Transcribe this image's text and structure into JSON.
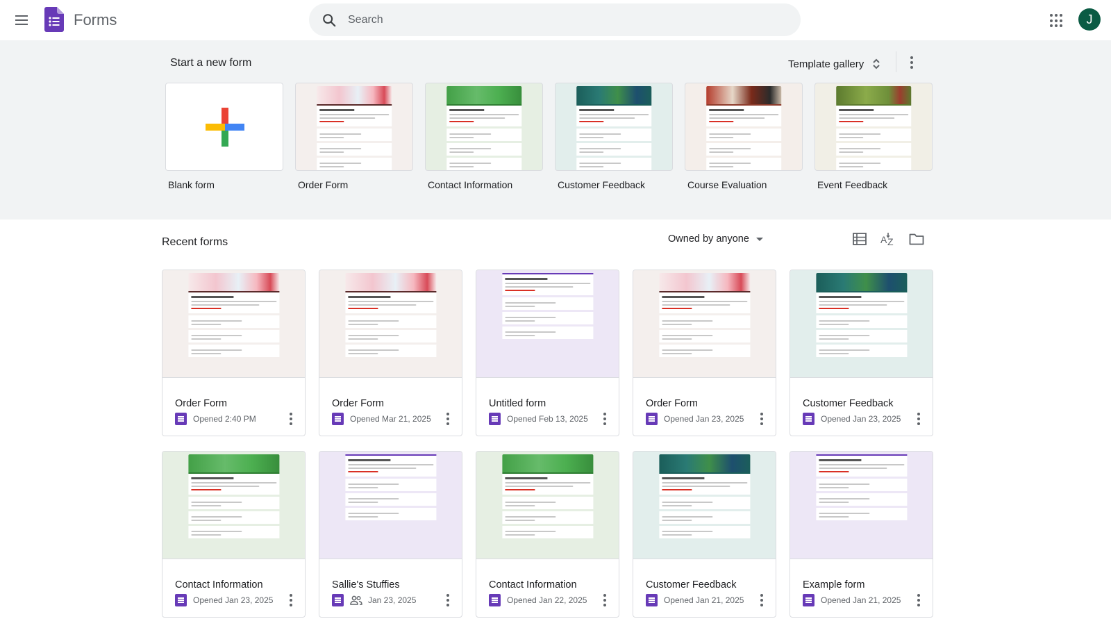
{
  "header": {
    "app_title": "Forms",
    "search_placeholder": "Search",
    "avatar_initial": "J"
  },
  "templates": {
    "heading": "Start a new form",
    "gallery_label": "Template gallery",
    "items": [
      {
        "name": "Blank form",
        "style": "blank"
      },
      {
        "name": "Order Form",
        "style": "floral"
      },
      {
        "name": "Contact Information",
        "style": "green"
      },
      {
        "name": "Customer Feedback",
        "style": "teal"
      },
      {
        "name": "Course Evaluation",
        "style": "grad"
      },
      {
        "name": "Event Feedback",
        "style": "park"
      }
    ]
  },
  "recent": {
    "heading": "Recent forms",
    "owner_filter": "Owned by anyone",
    "forms": [
      {
        "title": "Order Form",
        "opened": "Opened 2:40 PM",
        "style": "floral",
        "shared": false
      },
      {
        "title": "Order Form",
        "opened": "Opened Mar 21, 2025",
        "style": "floral",
        "shared": false
      },
      {
        "title": "Untitled form",
        "opened": "Opened Feb 13, 2025",
        "style": "plain",
        "shared": false
      },
      {
        "title": "Order Form",
        "opened": "Opened Jan 23, 2025",
        "style": "floral",
        "shared": false
      },
      {
        "title": "Customer Feedback",
        "opened": "Opened Jan 23, 2025",
        "style": "teal",
        "shared": false
      },
      {
        "title": "Contact Information",
        "opened": "Opened Jan 23, 2025",
        "style": "green",
        "shared": false
      },
      {
        "title": "Sallie's Stuffies",
        "opened": "Jan 23, 2025",
        "style": "plain",
        "shared": true
      },
      {
        "title": "Contact Information",
        "opened": "Opened Jan 22, 2025",
        "style": "green",
        "shared": false
      },
      {
        "title": "Customer Feedback",
        "opened": "Opened Jan 21, 2025",
        "style": "teal",
        "shared": false
      },
      {
        "title": "Example form",
        "opened": "Opened Jan 21, 2025",
        "style": "plain",
        "shared": false
      }
    ]
  },
  "colors": {
    "forms_purple": "#673ab7",
    "avatar_green": "#0b5b44",
    "floral_bg": "#f4efed",
    "green_bg": "#e6efe3",
    "teal_bg": "#e2eeec",
    "plain_bg": "#ede7f6"
  }
}
